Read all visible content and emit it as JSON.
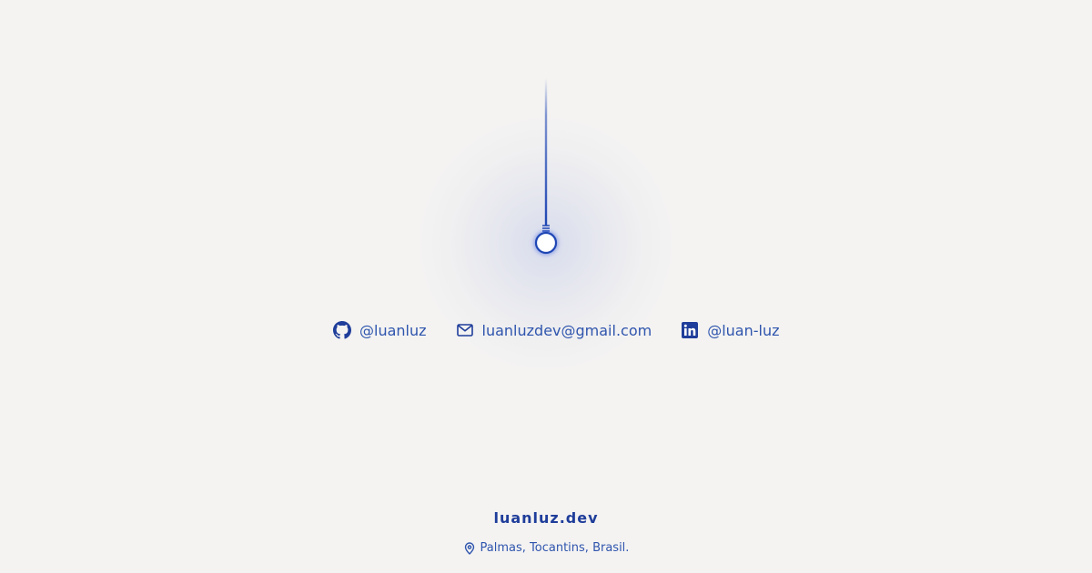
{
  "contacts": [
    {
      "icon": "github-icon",
      "label": "@luanluz"
    },
    {
      "icon": "mail-icon",
      "label": "luanluzdev@gmail.com"
    },
    {
      "icon": "linkedin-icon",
      "label": "@luan-luz"
    }
  ],
  "footer": {
    "brand": "luanluz.dev",
    "location_icon": "map-pin-icon",
    "location": "Palmas, Tocantins, Brasil."
  },
  "colors": {
    "background": "#f4f3f2",
    "accent": "#2f55ad",
    "accent_dark": "#1f3d9a",
    "wire": "#1e46b4"
  }
}
